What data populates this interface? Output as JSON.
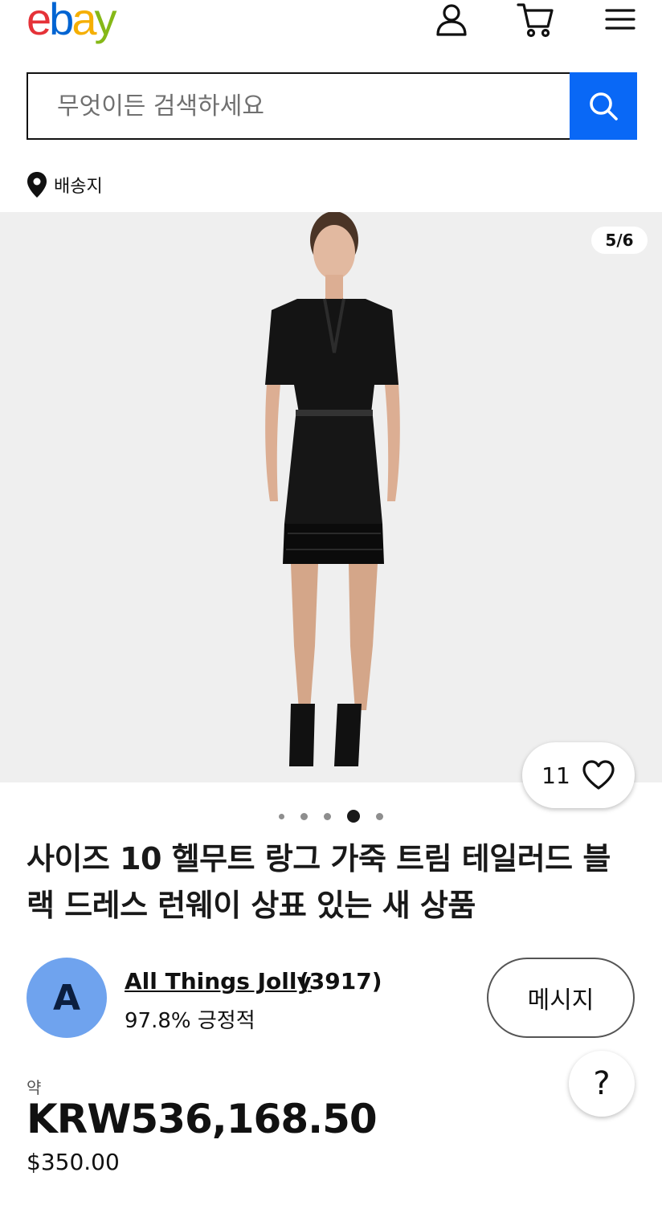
{
  "header": {
    "logo_letters": [
      "e",
      "b",
      "a",
      "y"
    ],
    "logo_colors": [
      "#e53238",
      "#0064d2",
      "#f5af02",
      "#86b817"
    ]
  },
  "search": {
    "placeholder": "무엇이든 검색하세요"
  },
  "ship_to": {
    "label": "배송지"
  },
  "gallery": {
    "counter": "5/6",
    "watch_count": "11",
    "dots": 5,
    "active_dot": 4
  },
  "listing": {
    "title": "사이즈 10 헬무트 랑그 가죽 트림 테일러드 블랙 드레스 런웨이 상표 있는 새 상품"
  },
  "seller": {
    "avatar_initial": "A",
    "name": "All Things Jolly",
    "count": "(3917)",
    "feedback": "97.8% 긍정적",
    "message_label": "메시지"
  },
  "help": {
    "label": "?"
  },
  "price": {
    "approx_label": "약",
    "converted": "KRW536,168.50",
    "original": "$350.00"
  },
  "colors": {
    "accent": "#0968f6",
    "avatar": "#6fa3ee"
  }
}
